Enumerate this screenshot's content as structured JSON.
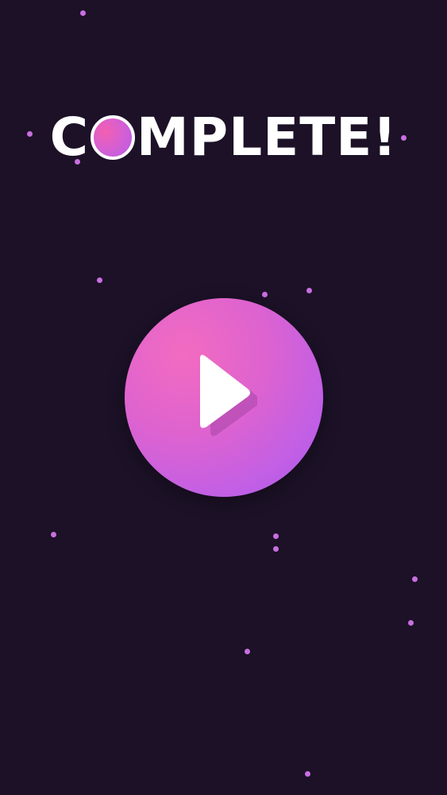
{
  "title": {
    "before_o": "C",
    "after_o": "MPLETE!",
    "o_icon": "pink-circle-icon"
  },
  "play_button": {
    "icon": "play-icon"
  },
  "colors": {
    "background": "#1c1127",
    "dots": "#c86fe0",
    "accent_pink": "#f26bc0",
    "accent_purple": "#b65ee8",
    "text": "#ffffff"
  }
}
